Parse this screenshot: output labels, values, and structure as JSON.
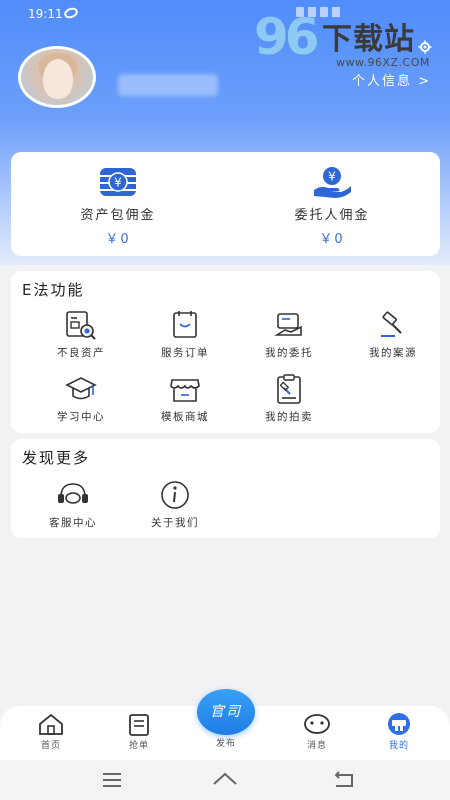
{
  "status_bar": {
    "time": "19:11"
  },
  "watermark": {
    "number": "96",
    "title": "下载站",
    "url": "www.96XZ.COM"
  },
  "profile": {
    "personal_info_label": "个人信息 >"
  },
  "commission": {
    "asset_package": {
      "label": "资产包佣金",
      "value": "￥0"
    },
    "client": {
      "label": "委托人佣金",
      "value": "￥0"
    }
  },
  "functions": {
    "title": "E法功能",
    "items": [
      {
        "label": "不良资产",
        "icon": "bad-assets-icon"
      },
      {
        "label": "服务订单",
        "icon": "service-order-icon"
      },
      {
        "label": "我的委托",
        "icon": "my-commission-icon"
      },
      {
        "label": "我的案源",
        "icon": "my-cases-icon"
      },
      {
        "label": "学习中心",
        "icon": "learning-center-icon"
      },
      {
        "label": "模板商城",
        "icon": "template-mall-icon"
      },
      {
        "label": "我的拍卖",
        "icon": "my-auction-icon"
      }
    ]
  },
  "more": {
    "title": "发现更多",
    "items": [
      {
        "label": "客服中心",
        "icon": "customer-service-icon"
      },
      {
        "label": "关于我们",
        "icon": "about-us-icon"
      }
    ]
  },
  "nav": {
    "items": [
      {
        "label": "首页",
        "icon": "home-icon"
      },
      {
        "label": "抢单",
        "icon": "grab-order-icon"
      },
      {
        "label": "发布",
        "icon": "publish-icon"
      },
      {
        "label": "消息",
        "icon": "message-icon"
      },
      {
        "label": "我的",
        "icon": "mine-icon"
      }
    ],
    "publish_button": "官司",
    "active": "我的"
  },
  "colors": {
    "accent": "#3b6fe0",
    "header_blue": "#4f8dfa",
    "nav_active": "#2e6ee8"
  }
}
